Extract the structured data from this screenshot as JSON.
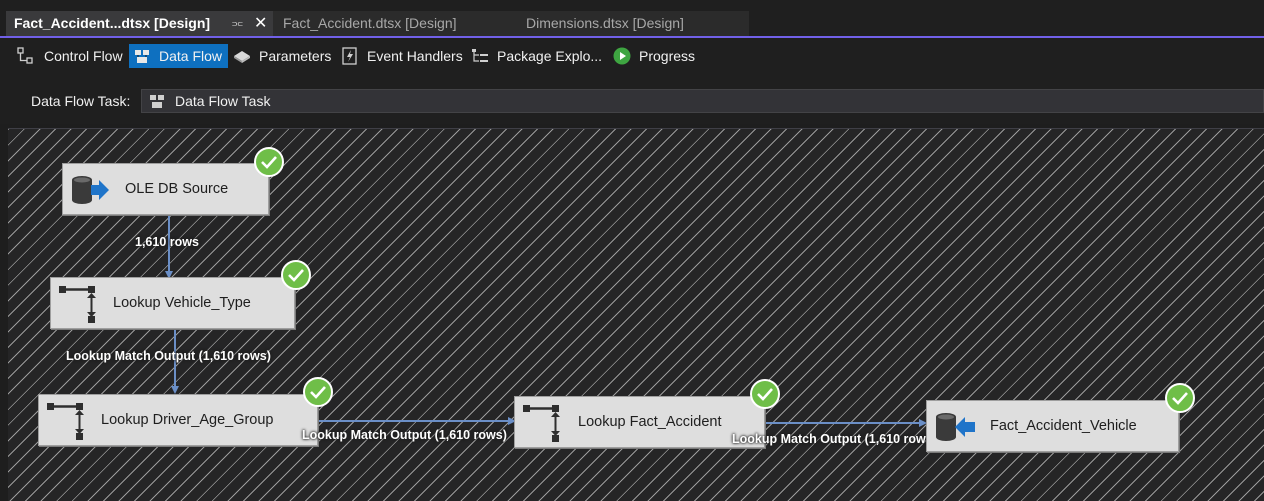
{
  "document_tabs": [
    {
      "label": "Fact_Accident...dtsx [Design]",
      "active": true
    },
    {
      "label": "Fact_Accident.dtsx [Design]",
      "active": false
    },
    {
      "label": "Dimensions.dtsx [Design]",
      "active": false
    }
  ],
  "tab_icons": {
    "pin": "pin-icon",
    "close": "close-icon"
  },
  "designer_tabs": [
    {
      "label": "Control Flow",
      "icon": "control-flow-icon",
      "active": false
    },
    {
      "label": "Data Flow",
      "icon": "data-flow-icon",
      "active": true
    },
    {
      "label": "Parameters",
      "icon": "parameters-icon",
      "active": false
    },
    {
      "label": "Event Handlers",
      "icon": "event-handlers-icon",
      "active": false
    },
    {
      "label": "Package Explo...",
      "icon": "package-explorer-icon",
      "active": false
    },
    {
      "label": "Progress",
      "icon": "progress-icon",
      "active": false
    }
  ],
  "task_bar": {
    "label": "Data Flow Task:",
    "selected": "Data Flow Task"
  },
  "components": [
    {
      "label": "OLE DB Source",
      "icon": "ole-db-source-icon",
      "status": "success"
    },
    {
      "label": "Lookup Vehicle_Type",
      "icon": "lookup-icon",
      "status": "success"
    },
    {
      "label": "Lookup Driver_Age_Group",
      "icon": "lookup-icon",
      "status": "success"
    },
    {
      "label": "Lookup Fact_Accident",
      "icon": "lookup-icon",
      "status": "success"
    },
    {
      "label": "Fact_Accident_Vehicle",
      "icon": "ole-db-destination-icon",
      "status": "success"
    }
  ],
  "paths": [
    {
      "label": "1,610 rows"
    },
    {
      "label": "Lookup Match Output (1,610 rows)"
    },
    {
      "label": "Lookup Match Output (1,610 rows)"
    },
    {
      "label": "Lookup Match Output (1,610 rows)"
    }
  ],
  "colors": {
    "accent": "#7160e8",
    "active_tab": "#0e70c0",
    "success": "#6fbe48",
    "path": "#6b8fc7"
  }
}
